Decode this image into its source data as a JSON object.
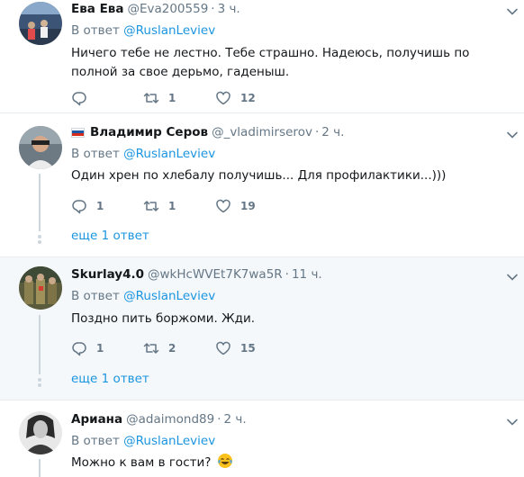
{
  "tweets": [
    {
      "name": "Ева Ева",
      "handle": "@Eva200559",
      "dot": "·",
      "time": "3 ч.",
      "reply_prefix": "В ответ",
      "reply_mention": "@RuslanLeviev",
      "text": "Ничего тебе не лестно. Тебе страшно. Надеюсь, получишь по полной за свое дерьмо, гаденыш.",
      "replies": "",
      "retweets": "1",
      "likes": "12"
    },
    {
      "name": "Владимир Серов",
      "handle": "@_vladimirserov",
      "dot": "·",
      "time": "2 ч.",
      "reply_prefix": "В ответ",
      "reply_mention": "@RuslanLeviev",
      "text": "Один хрен по хлебалу получишь... Для профилактики...)))",
      "replies": "1",
      "retweets": "1",
      "likes": "19",
      "more_label": "еще 1 ответ"
    },
    {
      "name": "Skurlay4.0",
      "handle": "@wkHcWVEt7K7wa5R",
      "dot": "·",
      "time": "11 ч.",
      "reply_prefix": "В ответ",
      "reply_mention": "@RuslanLeviev",
      "text": "Поздно пить боржоми. Жди.",
      "replies": "1",
      "retweets": "2",
      "likes": "15",
      "more_label": "еще 1 ответ"
    },
    {
      "name": "Ариана",
      "handle": "@adaimond89",
      "dot": "·",
      "time": "2 ч.",
      "reply_prefix": "В ответ",
      "reply_mention": "@RuslanLeviev",
      "text": "Можно к вам в гости?"
    }
  ],
  "icons": {
    "reply": "reply-icon",
    "retweet": "retweet-icon",
    "like": "heart-icon",
    "caret": "chevron-down-icon",
    "flag": "russia-flag-icon",
    "emoji": "tears-of-joy-emoji"
  },
  "colors": {
    "link": "#1b95e0",
    "secondary": "#657786",
    "highlight_bg": "#f5f8fa",
    "border": "#e6ecf0"
  }
}
